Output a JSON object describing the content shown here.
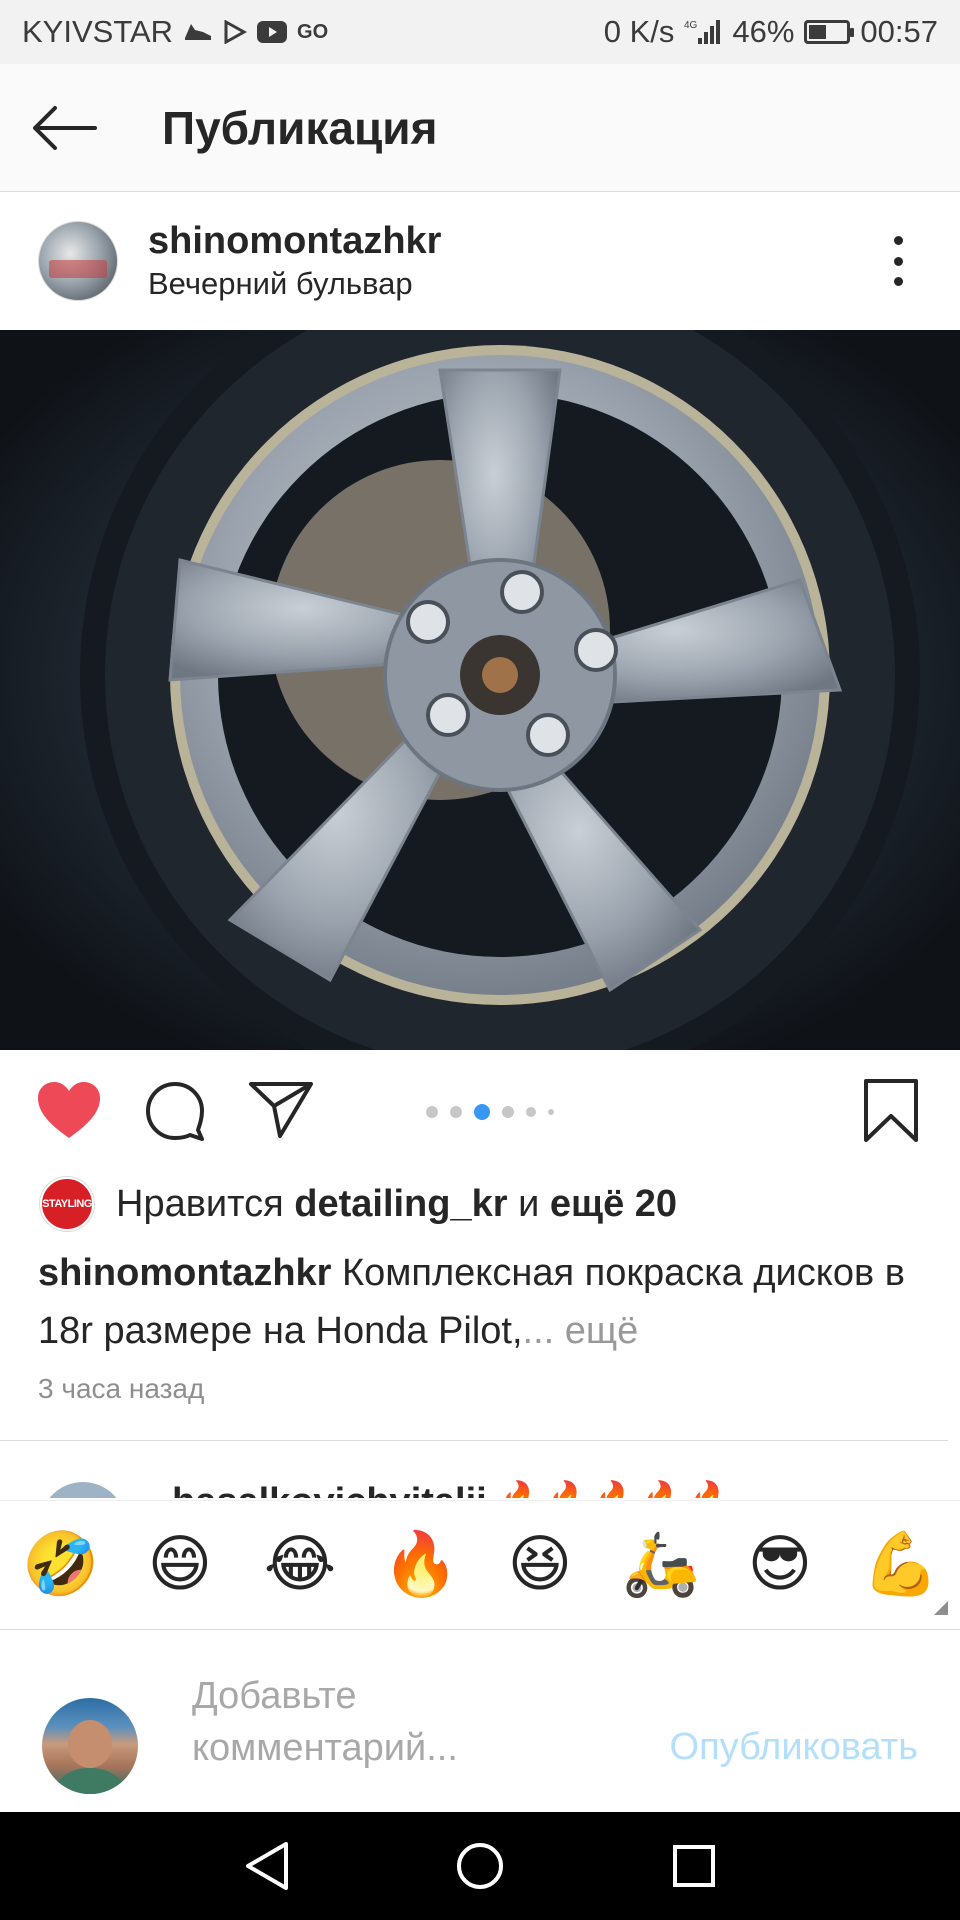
{
  "status_bar": {
    "carrier": "KYIVSTAR",
    "app_icons": [
      "sneaker-icon",
      "play-store-icon",
      "youtube-icon",
      "go-icon"
    ],
    "net_speed": "0 K/s",
    "network": "4G",
    "battery_percent": "46%",
    "battery_level": 0.46,
    "time": "00:57"
  },
  "app_bar": {
    "title": "Публикация",
    "back_icon": "arrow-left-icon"
  },
  "post": {
    "username": "shinomontazhkr",
    "location": "Вечерний бульвар",
    "menu_icon": "more-vertical-icon",
    "image_description_icon": "wheel-photo",
    "carousel": {
      "count": 6,
      "active_index": 2
    },
    "liked": true,
    "likes": {
      "prefix": "Нравится ",
      "user": "detailing_kr",
      "middle": " и ",
      "others": "ещё 20",
      "avatar_text": "STAYLING"
    },
    "caption": {
      "user": "shinomontazhkr",
      "text": " Комплексная покраска дисков в 18r размере на Honda Pilot,",
      "ellipsis": "...",
      "more": " ещё"
    },
    "time_ago": "3 часа назад"
  },
  "comment_preview": {
    "username": "hasalkovichvitalii",
    "emojis": "🔥🔥🔥🔥🔥"
  },
  "emoji_bar": {
    "items": [
      "🤣",
      "😄",
      "😂",
      "🔥",
      "😆",
      "🛵",
      "😎",
      "💪"
    ]
  },
  "composer": {
    "placeholder": "Добавьте комментарий...",
    "publish": "Опубликовать"
  },
  "colors": {
    "like_red": "#ed4956",
    "link_blue_disabled": "#b2dffc",
    "dot_active": "#3897f0",
    "text": "#262626",
    "muted": "#8e8e8e"
  }
}
